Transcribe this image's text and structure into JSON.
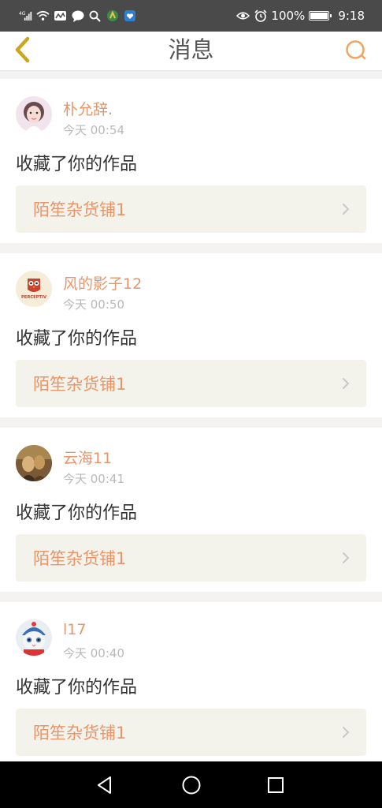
{
  "status_bar": {
    "signal_text": "4G",
    "battery_percent": "100%",
    "time": "9:18",
    "icons": [
      "signal-icon",
      "wifi-icon",
      "activity-icon",
      "chat-icon",
      "search-icon",
      "app-icon",
      "shield-icon",
      "eye-icon",
      "alarm-icon",
      "battery-icon"
    ]
  },
  "header": {
    "title": "消息",
    "back_icon": "chevron-left-icon",
    "search_icon": "search-icon"
  },
  "accent_color": "#e8956a",
  "messages": [
    {
      "username": "朴允辞.",
      "time": "今天 00:54",
      "action": "收藏了你的作品",
      "store": "陌笙杂货铺1"
    },
    {
      "username": "风的影子12",
      "time": "今天 00:50",
      "action": "收藏了你的作品",
      "store": "陌笙杂货铺1",
      "avatar_text": "PERCEPTIV"
    },
    {
      "username": "云海11",
      "time": "今天 00:41",
      "action": "收藏了你的作品",
      "store": "陌笙杂货铺1"
    },
    {
      "username": "l17",
      "time": "今天 00:40",
      "action": "收藏了你的作品",
      "store": "陌笙杂货铺1"
    }
  ],
  "nav_bar": {
    "icons": [
      "back-triangle-icon",
      "home-circle-icon",
      "recents-square-icon"
    ]
  }
}
